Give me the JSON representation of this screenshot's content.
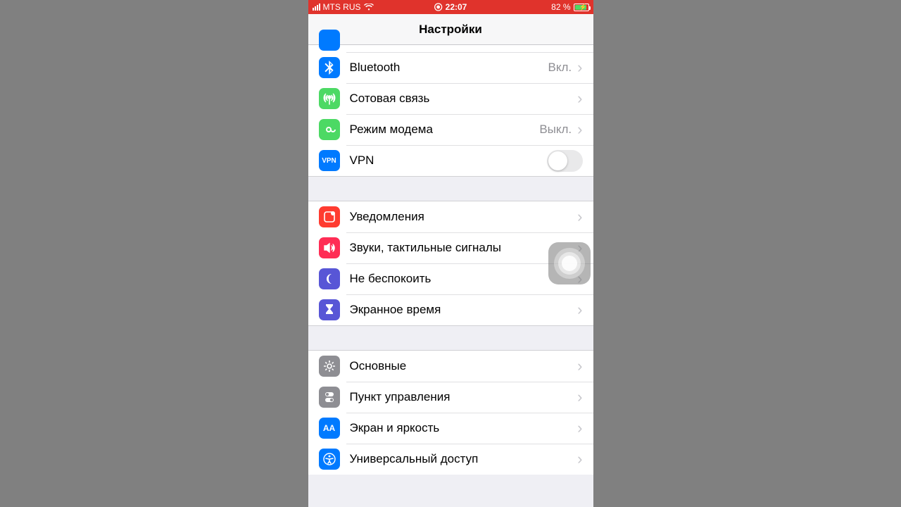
{
  "status": {
    "carrier": "MTS RUS",
    "time": "22:07",
    "battery_pct": "82 %"
  },
  "header": {
    "title": "Настройки"
  },
  "rows": {
    "bluetooth": {
      "label": "Bluetooth",
      "detail": "Вкл."
    },
    "cellular": {
      "label": "Сотовая связь"
    },
    "hotspot": {
      "label": "Режим модема",
      "detail": "Выкл."
    },
    "vpn": {
      "label": "VPN",
      "icon_text": "VPN"
    },
    "notifications": {
      "label": "Уведомления"
    },
    "sounds": {
      "label": "Звуки, тактильные сигналы"
    },
    "dnd": {
      "label": "Не беспокоить"
    },
    "screentime": {
      "label": "Экранное время"
    },
    "general": {
      "label": "Основные"
    },
    "controlcenter": {
      "label": "Пункт управления"
    },
    "display": {
      "label": "Экран и яркость",
      "icon_text": "AA"
    },
    "accessibility": {
      "label": "Универсальный доступ"
    }
  }
}
